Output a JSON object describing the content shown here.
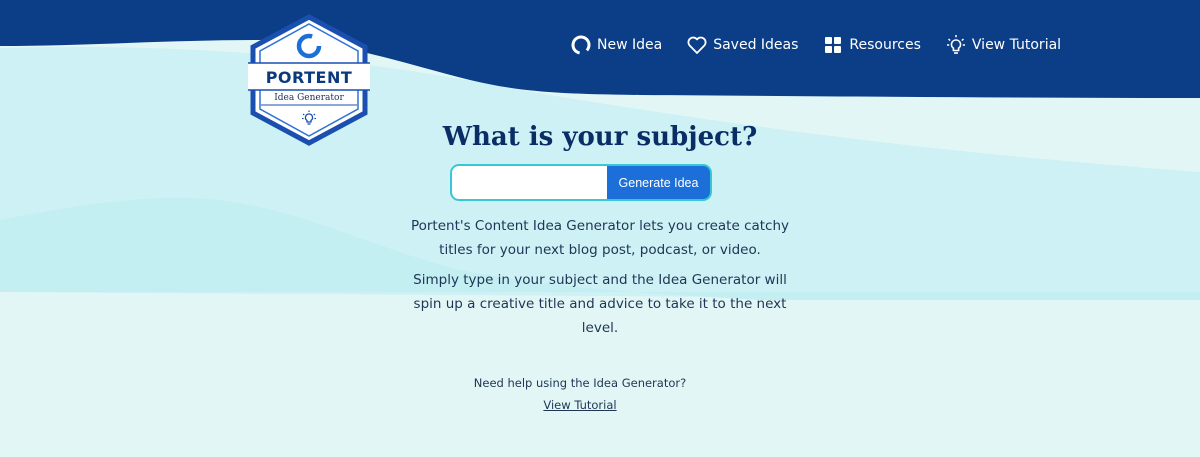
{
  "logo": {
    "brand": "PORTENT",
    "subtitle": "Idea Generator",
    "icon": "lightbulb-icon"
  },
  "nav": [
    {
      "label": "New Idea",
      "icon": "refresh-circle-icon"
    },
    {
      "label": "Saved Ideas",
      "icon": "heart-icon"
    },
    {
      "label": "Resources",
      "icon": "grid-icon"
    },
    {
      "label": "View Tutorial",
      "icon": "lightbulb-icon"
    }
  ],
  "main": {
    "heading": "What is your subject?",
    "input_value": "",
    "input_placeholder": "",
    "button_label": "Generate Idea",
    "description_1": "Portent's Content Idea Generator lets you create catchy titles for your next blog post, podcast, or video.",
    "description_2": "Simply type in your subject and the Idea Generator will spin up a creative title and advice to take it to the next level.",
    "help_text": "Need help using the Idea Generator?",
    "help_link": "View Tutorial"
  },
  "colors": {
    "header_navy": "#0b3e87",
    "accent_blue": "#1c6fd8",
    "input_border_cyan": "#39c7d6",
    "heading_navy": "#0a2d66",
    "background_light": "#e2f7f5"
  }
}
